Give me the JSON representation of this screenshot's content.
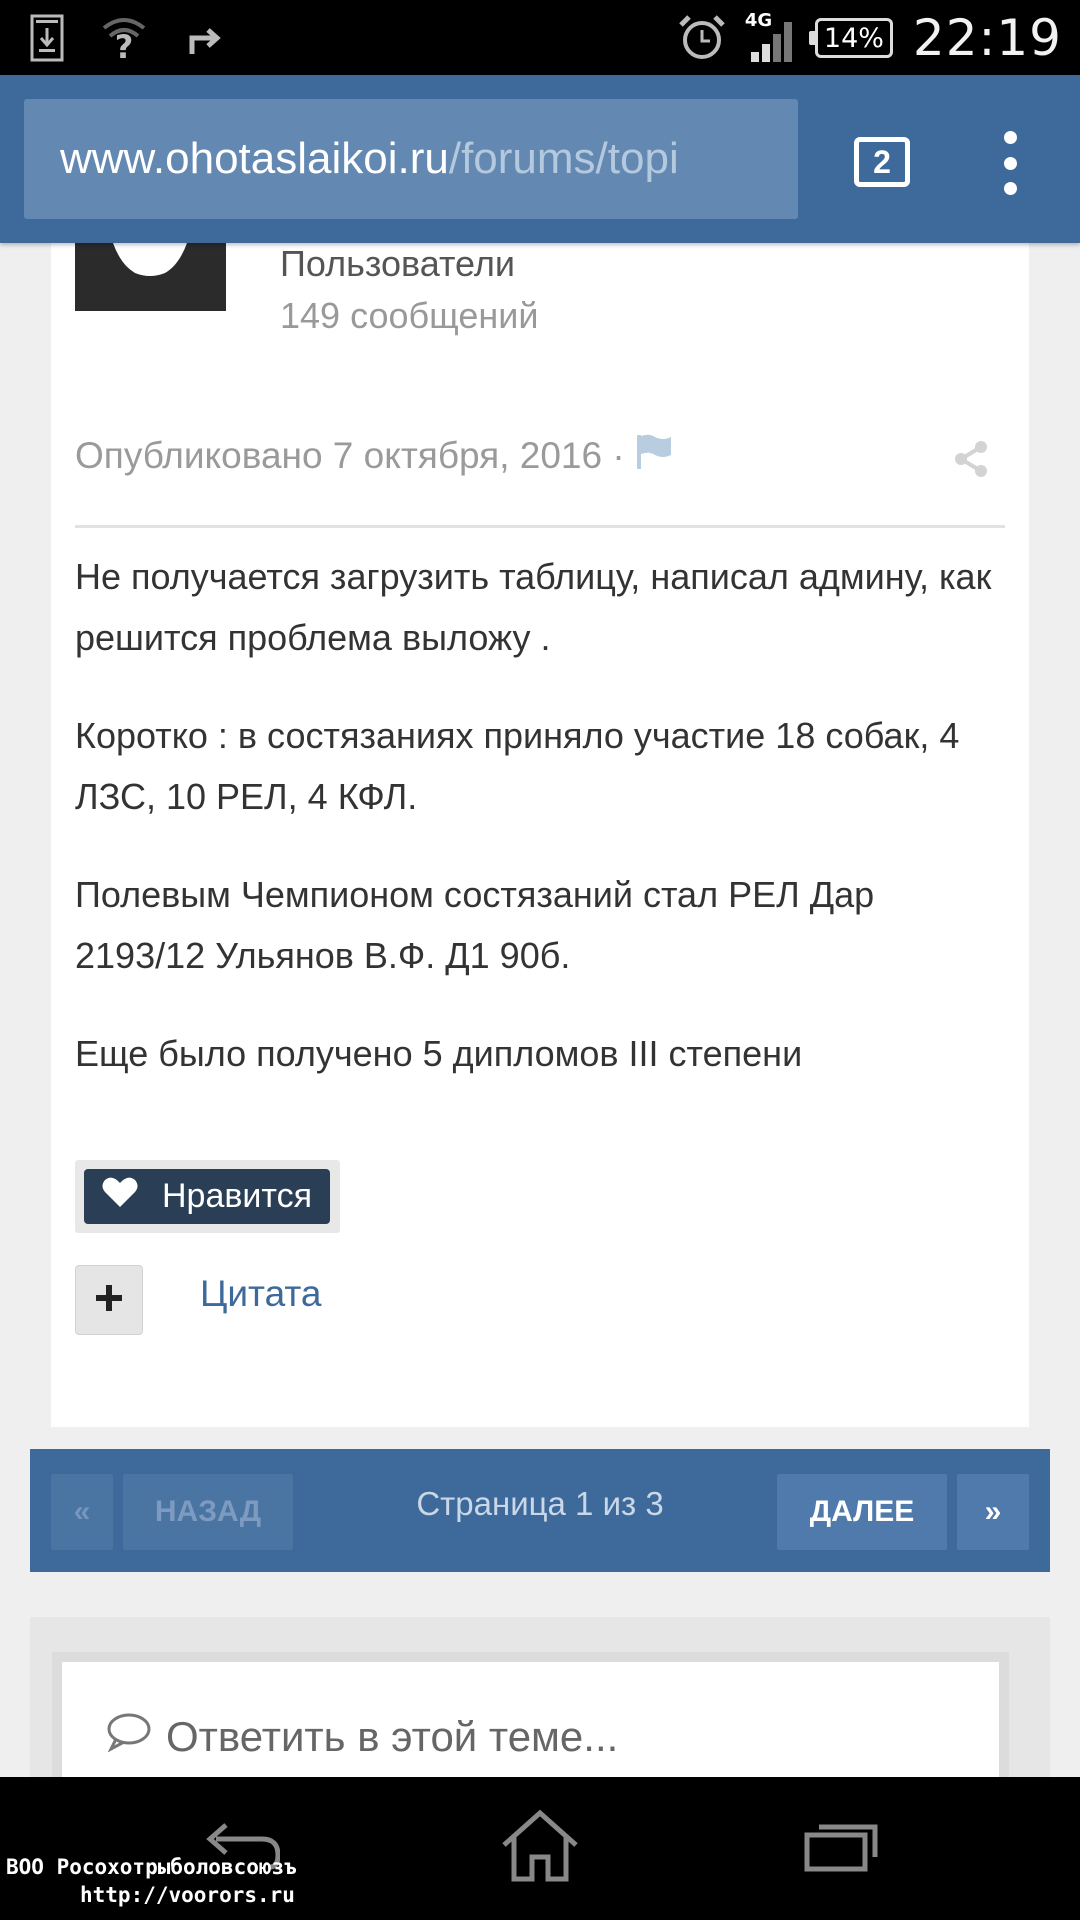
{
  "status_bar": {
    "network_label": "4G",
    "battery_percent": "14%",
    "time": "22:19"
  },
  "browser": {
    "url_host": "www.ohotaslaikoi.ru",
    "url_path": "/forums/topi",
    "tab_count": "2"
  },
  "post": {
    "author_group": "Пользователи",
    "author_posts": "149 сообщений",
    "published": "Опубликовано 7 октября, 2016 ·",
    "body": [
      "Не получается загрузить таблицу, написал админу, как решится проблема выложу .",
      "Коротко : в состязаниях приняло участие 18 собак, 4 ЛЗС, 10 РЕЛ, 4 КФЛ.",
      "Полевым Чемпионом состязаний стал РЕЛ Дар 2193/12 Ульянов В.Ф. Д1 90б.",
      "Еще было получено 5 дипломов III степени"
    ],
    "like_label": "Нравится",
    "quote_label": "Цитата"
  },
  "pagination": {
    "first_label": "«",
    "prev_label": "НАЗАД",
    "info": "Страница 1 из 3",
    "next_label": "ДАЛЕЕ",
    "last_label": "»"
  },
  "reply": {
    "placeholder": "Ответить в этой теме..."
  },
  "watermark": {
    "line1": "ВОО Росохотрыболовсоюзъ",
    "line2": "http://voorors.ru"
  },
  "colors": {
    "brand_blue": "#3d6a9a",
    "like_button": "#2a3f55",
    "link": "#3d6a9a"
  }
}
